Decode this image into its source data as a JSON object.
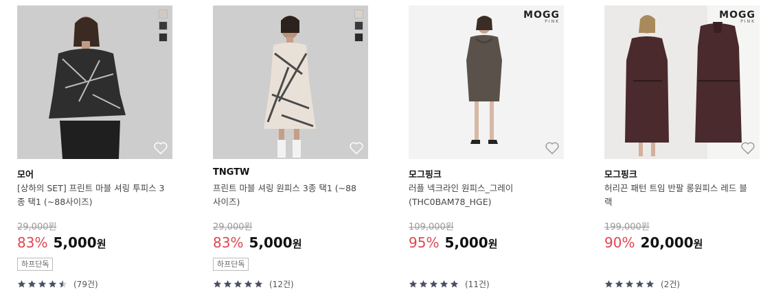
{
  "products": [
    {
      "brand": "모어",
      "name": "[상하의 SET] 프린트 마블 셔링 투피스 3종 택1 (~88사이즈)",
      "original_price": "29,000원",
      "discount": "83%",
      "price": "5,000",
      "currency": "원",
      "badge": "하프단독",
      "rating_stars": 4.5,
      "review_count": "(79건)",
      "swatches": [
        "#cfc9c5",
        "#3a3a3a",
        "#2f3033"
      ],
      "logo": null,
      "bg": "#cfcfcf",
      "outfit": "#2a2a2a"
    },
    {
      "brand": "TNGTW",
      "name": "프린트 마블 셔링 원피스 3종 택1 (~88사이즈)",
      "original_price": "29,000원",
      "discount": "83%",
      "price": "5,000",
      "currency": "원",
      "badge": "하프단독",
      "rating_stars": 5,
      "review_count": "(12건)",
      "swatches": [
        "#d9d2c8",
        "#3a3a3a",
        "#2a2a2a"
      ],
      "logo": null,
      "bg": "#cfcfcf",
      "outfit": "#e8e0d6"
    },
    {
      "brand": "모그핑크",
      "name": "러플 넥크라인 원피스_그레이 (THC0BAM78_HGE)",
      "original_price": "109,000원",
      "discount": "95%",
      "price": "5,000",
      "currency": "원",
      "badge": null,
      "rating_stars": 5,
      "review_count": "(11건)",
      "swatches": [],
      "logo": {
        "main": "MOGG",
        "sub": "PINK"
      },
      "bg": "#f3f3f3",
      "outfit": "#5a524a"
    },
    {
      "brand": "모그핑크",
      "name": "허리끈 패턴 트임 반팔 롱원피스 레드 블랙",
      "original_price": "199,000원",
      "discount": "90%",
      "price": "20,000",
      "currency": "원",
      "badge": null,
      "rating_stars": 5,
      "review_count": "(2건)",
      "swatches": [],
      "logo": {
        "main": "MOGG",
        "sub": "PINK"
      },
      "bg": "#ececea",
      "outfit": "#4a2a2c"
    }
  ],
  "icons": {
    "heart": "heart-outline-icon",
    "star": "star-icon"
  },
  "colors": {
    "discount": "#e0454e",
    "star": "#4a4f63"
  }
}
